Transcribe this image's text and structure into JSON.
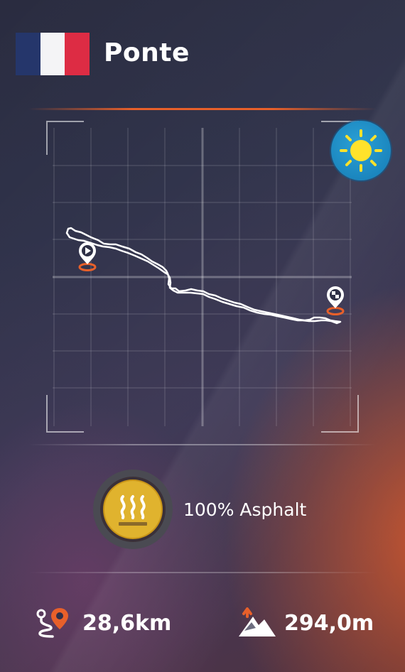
{
  "header": {
    "country_flag": "france-flag",
    "title": "Ponte"
  },
  "weather": {
    "icon": "sun-icon",
    "accent": "#1f8fc8"
  },
  "map": {
    "start_marker": "start-pin-icon",
    "finish_marker": "finish-flag-pin-icon",
    "route_color": "#ffffff",
    "marker_ring_color": "#e8602a"
  },
  "surface": {
    "icon": "heat-waves-icon",
    "label": "100% Asphalt",
    "badge_color": "#e0b32e"
  },
  "stats": {
    "distance": {
      "icon": "route-pin-icon",
      "value": "28,6km"
    },
    "elevation": {
      "icon": "mountain-elevation-icon",
      "value": "294,0m"
    }
  },
  "colors": {
    "accent": "#e8602a"
  }
}
